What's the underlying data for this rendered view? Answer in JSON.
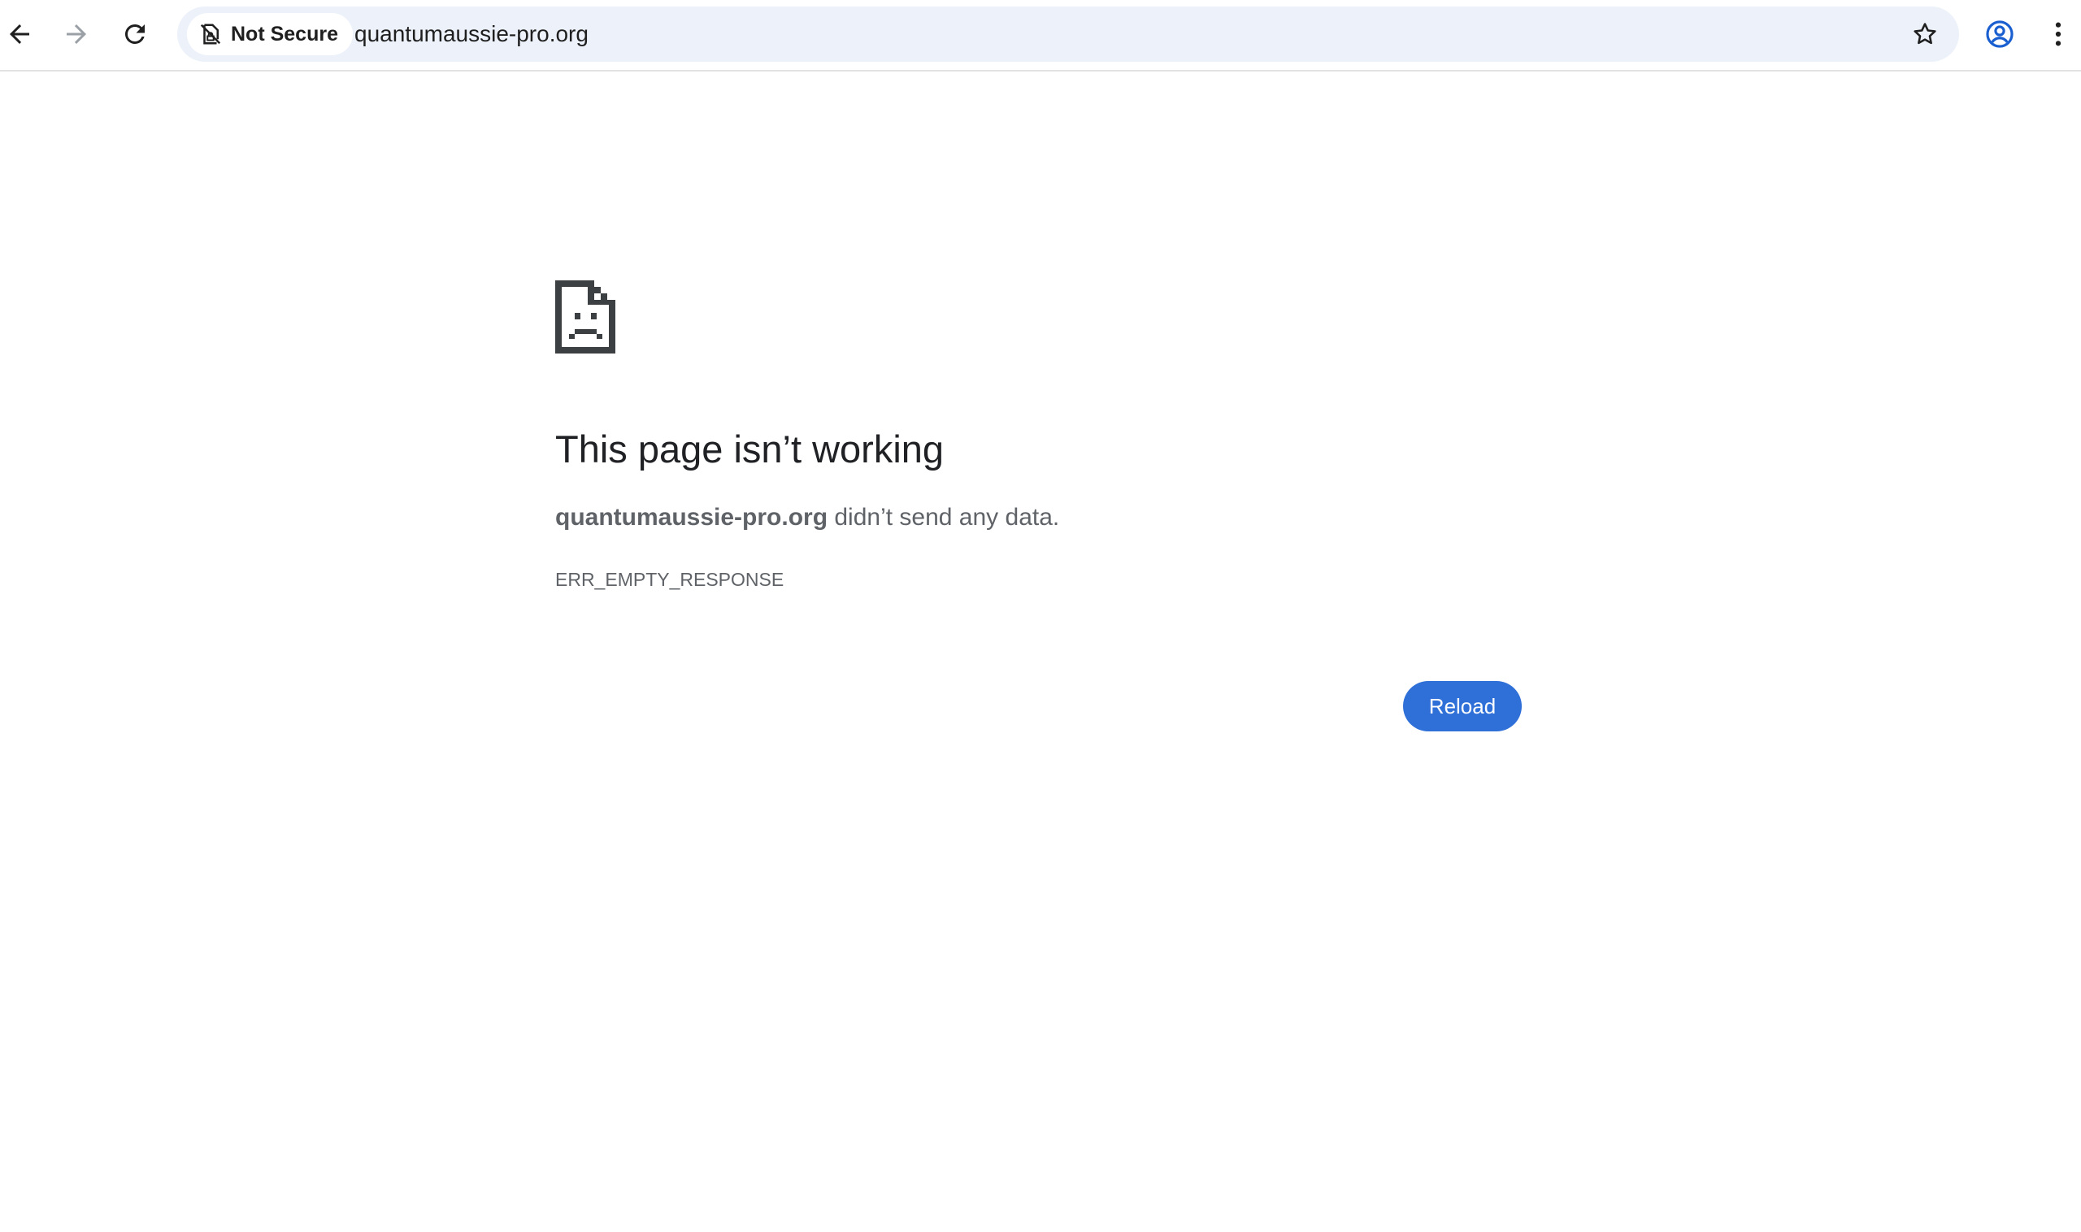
{
  "browser": {
    "security_label": "Not Secure",
    "url": "quantumaussie-pro.org",
    "icons": {
      "back": "arrow-left-icon",
      "forward": "arrow-right-icon",
      "reload": "reload-icon",
      "security": "not-secure-icon",
      "bookmark": "star-icon",
      "profile": "profile-icon",
      "menu": "kebab-menu-icon"
    }
  },
  "error": {
    "icon": "sad-page-icon",
    "title": "This page isn’t working",
    "host": "quantumaussie-pro.org",
    "message": " didn’t send any data.",
    "code": "ERR_EMPTY_RESPONSE",
    "reload_label": "Reload"
  },
  "colors": {
    "accent": "#1a73e8",
    "omnibox_bg": "#edf2fa",
    "title": "#202124",
    "secondary_text": "#5f6368"
  }
}
